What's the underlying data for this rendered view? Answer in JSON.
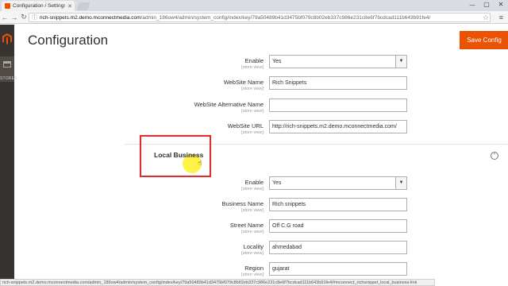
{
  "browser": {
    "tab_title": "Configuration / Settings",
    "url_host": "rich-snippets.m2.demo.mconnectmedia.com",
    "url_path": "/admin_186ow4/admin/system_config/index/key/79a50489b41d3475bf079c8b02eb337c986e231c8e6f7bcdcad111b643b91fe4/",
    "status_url": "rich-snippets.m2.demo.mconnectmedia.com/admin_186ow4/admin/system_config/index/key/79a50489b41d3475bf079c8b02eb337c986e231c8e6f7bcdcad111b643b91fe4/#mconnect_richsnippet_local_business-link"
  },
  "sidebar": {
    "stores_label": "STORES"
  },
  "header": {
    "title": "Configuration",
    "save_label": "Save Config"
  },
  "fields": [
    {
      "label": "Enable",
      "scope": "[store view]",
      "value": "Yes",
      "type": "select"
    },
    {
      "label": "WebSite Name",
      "scope": "[store view]",
      "value": "Rich Snippets",
      "type": "text"
    },
    {
      "label": "WebSite Alternative Name",
      "scope": "[store view]",
      "value": "",
      "type": "text"
    },
    {
      "label": "WebSite URL",
      "scope": "[store view]",
      "value": "http://rich-snippets.m2.demo.mconnectmedia.com/",
      "type": "text"
    }
  ],
  "local_business": {
    "title": "Local Business",
    "fields": [
      {
        "label": "Enable",
        "scope": "[store view]",
        "value": "Yes",
        "type": "select"
      },
      {
        "label": "Business Name",
        "scope": "[store view]",
        "value": "Rich snippets",
        "type": "text"
      },
      {
        "label": "Street Name",
        "scope": "[store view]",
        "value": "Off C.G road",
        "type": "text"
      },
      {
        "label": "Locality",
        "scope": "[store view]",
        "value": "ahmedabad",
        "type": "text"
      },
      {
        "label": "Region",
        "scope": "[store view]",
        "value": "gujarat",
        "type": "text"
      }
    ]
  },
  "colors": {
    "accent": "#eb5202",
    "sidebar": "#373330",
    "highlight_box": "#e02c2c"
  }
}
